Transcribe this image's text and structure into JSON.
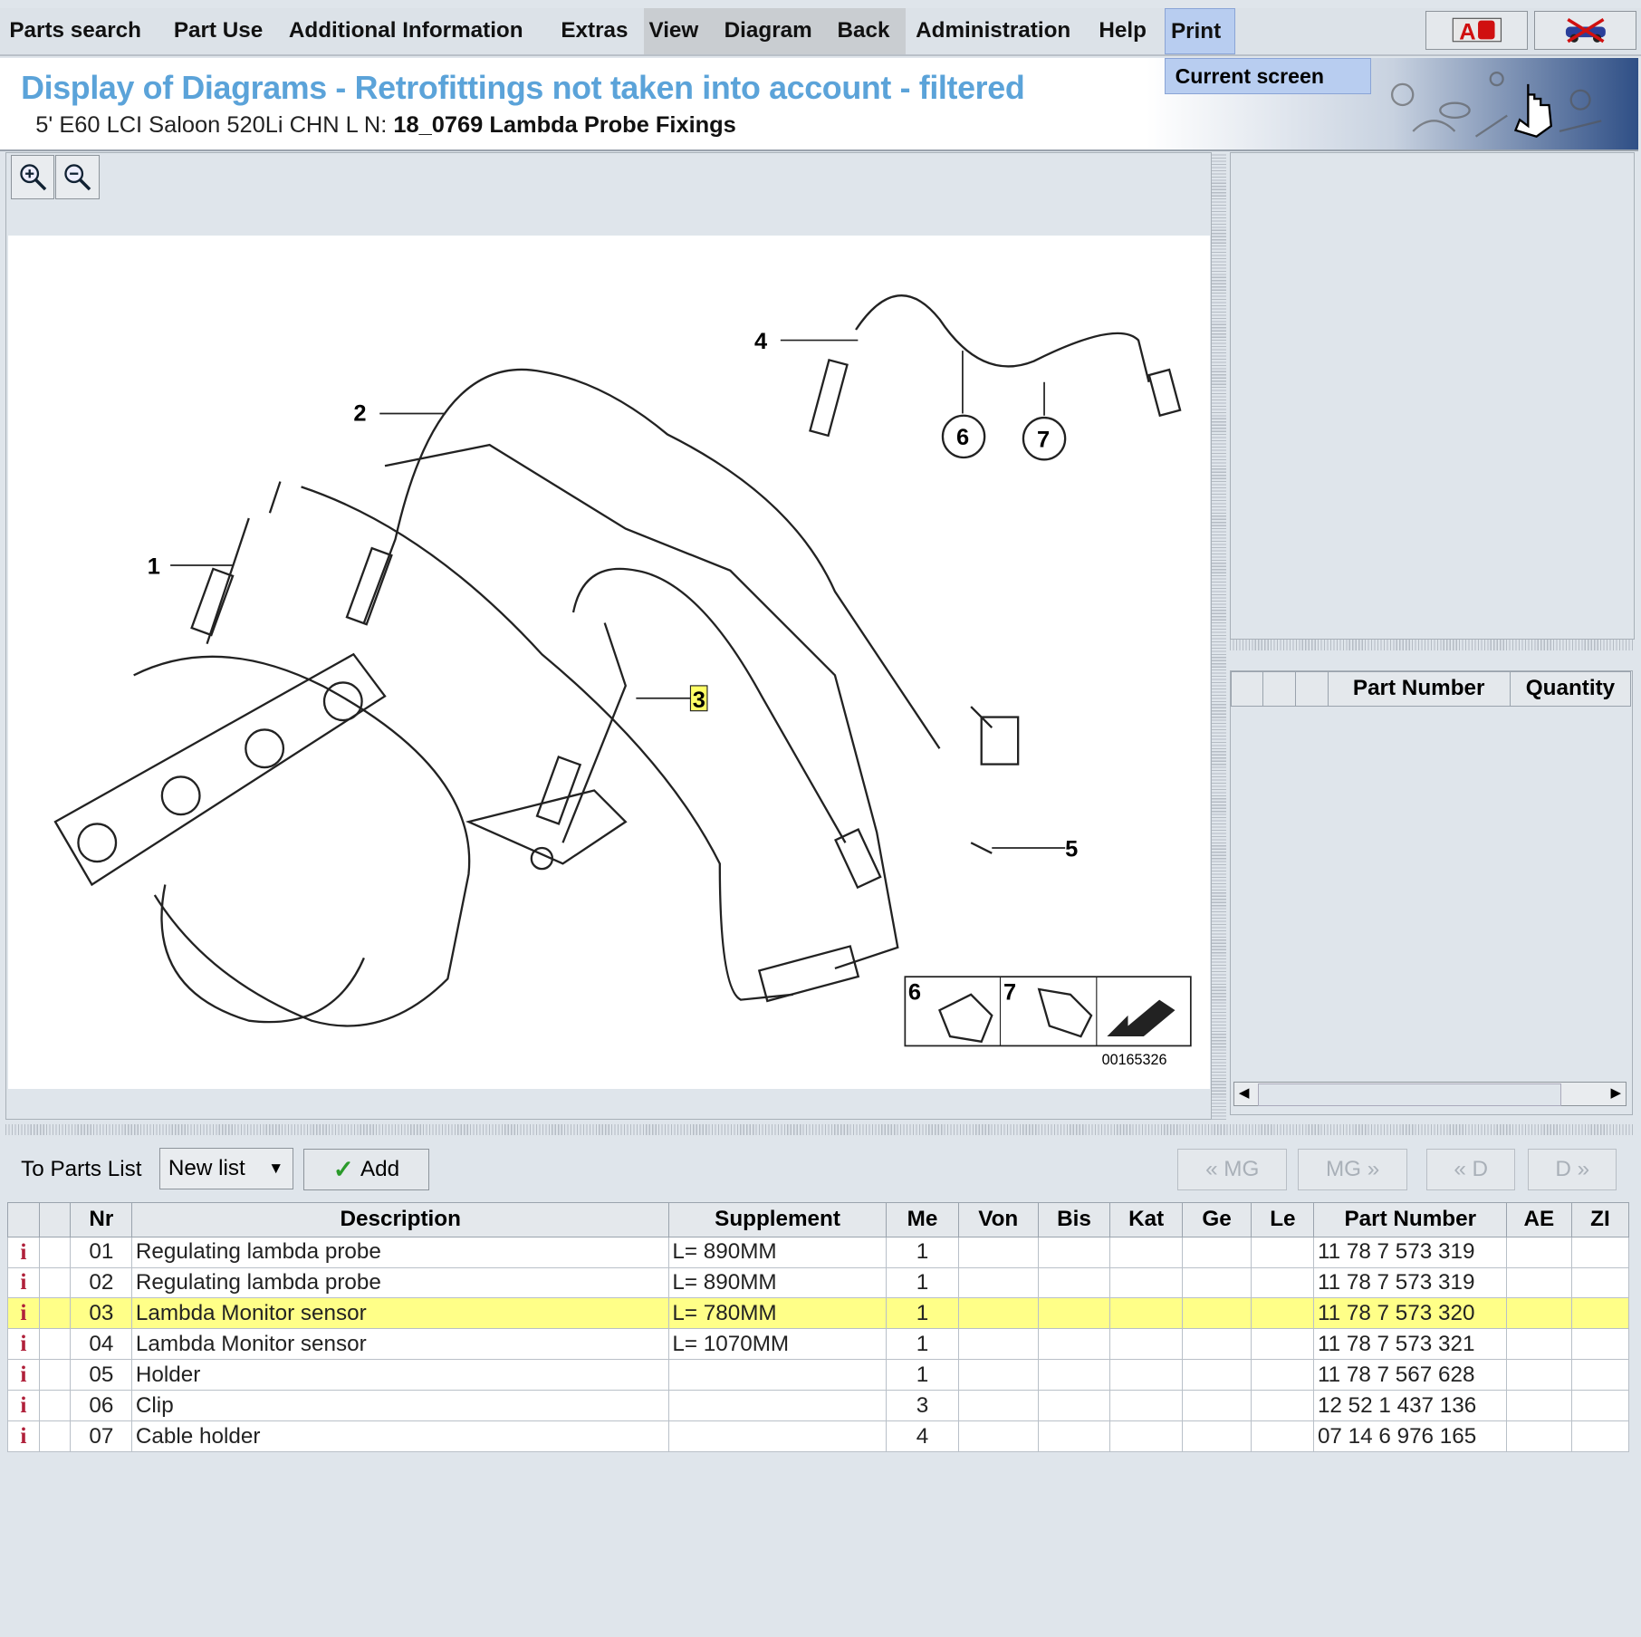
{
  "menu": [
    "Parts search",
    "Part Use",
    "Additional Information",
    "Extras",
    "View",
    "Diagram",
    "Back",
    "Administration",
    "Help",
    "Print"
  ],
  "print_menu": {
    "item": "Current screen"
  },
  "header": {
    "title": "Display of Diagrams - Retrofittings not taken into account - filtered",
    "vehicle": "5' E60 LCI Saloon 520Li CHN  L N: ",
    "group": "18_0769 Lambda Probe Fixings"
  },
  "diagram": {
    "callouts": [
      "1",
      "2",
      "3",
      "4",
      "5",
      "6",
      "7"
    ],
    "inset_labels": [
      "6",
      "7"
    ],
    "image_number": "00165326"
  },
  "side_table": {
    "headers": [
      "",
      "",
      "",
      "Part Number",
      "Quantity"
    ]
  },
  "toolbar": {
    "to_parts_list": "To Parts List",
    "list_select": "New list",
    "add": "Add",
    "nav": [
      "« MG",
      "MG »",
      "« D",
      "D »"
    ]
  },
  "table": {
    "headers": [
      "",
      "",
      "Nr",
      "Description",
      "Supplement",
      "Me",
      "Von",
      "Bis",
      "Kat",
      "Ge",
      "Le",
      "Part Number",
      "AE",
      "ZI"
    ],
    "rows": [
      {
        "icon": "i",
        "nr": "01",
        "desc": "Regulating lambda probe",
        "supp": "L= 890MM",
        "me": "1",
        "pn": "11 78 7 573 319"
      },
      {
        "icon": "i",
        "nr": "02",
        "desc": "Regulating lambda probe",
        "supp": "L= 890MM",
        "me": "1",
        "pn": "11 78 7 573 319"
      },
      {
        "icon": "i",
        "nr": "03",
        "desc": "Lambda Monitor sensor",
        "supp": "L= 780MM",
        "me": "1",
        "pn": "11 78 7 573 320",
        "selected": true
      },
      {
        "icon": "i",
        "nr": "04",
        "desc": "Lambda Monitor sensor",
        "supp": "L= 1070MM",
        "me": "1",
        "pn": "11 78 7 573 321"
      },
      {
        "icon": "i",
        "nr": "05",
        "desc": "Holder",
        "supp": "",
        "me": "1",
        "pn": "11 78 7 567 628"
      },
      {
        "icon": "i",
        "nr": "06",
        "desc": "Clip",
        "supp": "",
        "me": "3",
        "pn": "12 52 1 437 136"
      },
      {
        "icon": "i",
        "nr": "07",
        "desc": "Cable holder",
        "supp": "",
        "me": "4",
        "pn": "07 14 6 976 165"
      }
    ]
  },
  "colors": {
    "title": "#5ba3d9",
    "highlight": "#ffff88",
    "menu_selected": "#b8cdf0"
  }
}
